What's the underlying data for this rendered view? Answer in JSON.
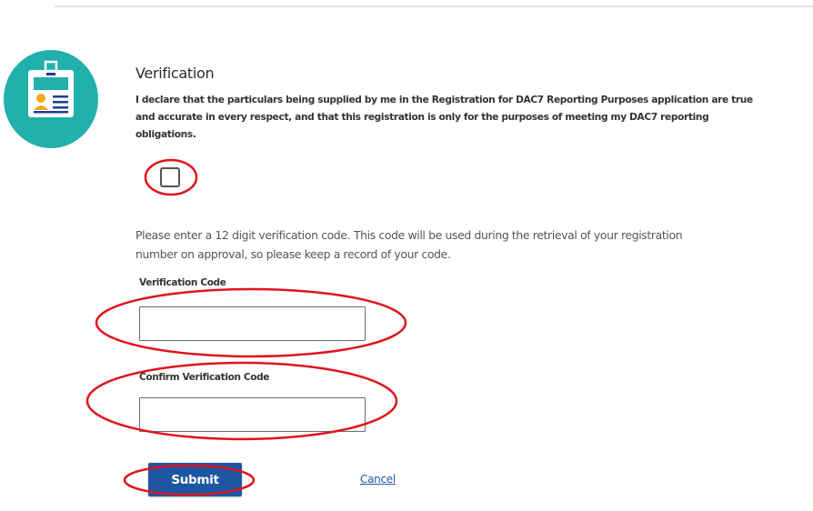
{
  "colors": {
    "badge_teal": "#22b0ad",
    "primary_blue": "#1d57a3",
    "annotation_red": "#e0141c"
  },
  "verification": {
    "icon": "id-badge-icon",
    "heading": "Verification",
    "declaration": "I declare that the particulars being supplied by me in the Registration for DAC7 Reporting Purposes application are true and accurate in every respect, and that this registration is only for the purposes of meeting my DAC7 reporting obligations.",
    "declaration_checked": false
  },
  "code_section": {
    "instructions": "Please enter a 12 digit verification code. This code will be used during the retrieval of your registration number on approval, so please keep a record of your code.",
    "verification_code": {
      "label": "Verification Code",
      "value": ""
    },
    "confirm_verification_code": {
      "label": "Confirm Verification Code",
      "value": ""
    }
  },
  "actions": {
    "submit_label": "Submit",
    "cancel_label": "Cancel"
  }
}
